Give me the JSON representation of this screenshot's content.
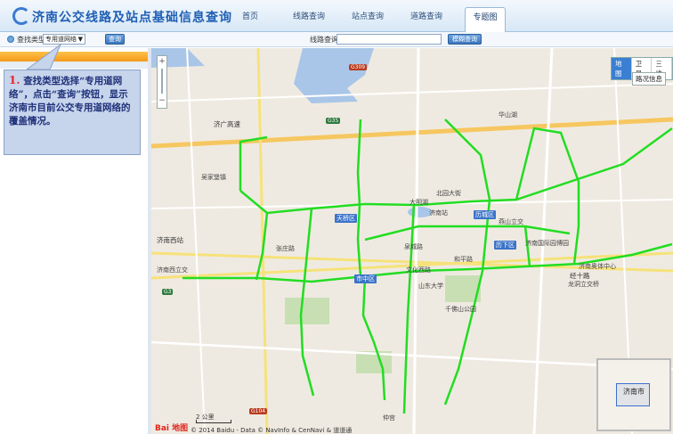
{
  "header": {
    "title": "济南公交线路及站点基础信息查询",
    "nav": [
      {
        "label": "首页",
        "active": false
      },
      {
        "label": "线路查询",
        "active": false
      },
      {
        "label": "站点查询",
        "active": false
      },
      {
        "label": "道路查询",
        "active": false
      },
      {
        "label": "专题图",
        "active": true
      }
    ]
  },
  "toolbar": {
    "find_type_label": "查找类型",
    "find_type_value": "专用道网络",
    "query_button": "查询",
    "line_query_label": "线路查询",
    "fuzzy_query_button": "模糊查询"
  },
  "note": {
    "number": "1.",
    "text": "查找类型选择“专用道网络”，点击“查询”按钮，显示济南市目前公交专用道网络的覆盖情况。"
  },
  "map": {
    "zoom_plus": "+",
    "zoom_minus": "−",
    "map_types": [
      "地图",
      "卫星",
      "三维"
    ],
    "traffic_label": "路况信息",
    "scale_label": "2 公里",
    "copyright": "© 2014 Baidu - Data © NavInfo & CenNavi & 道道通",
    "baidu_logo": "Bai 地图",
    "overview_label": "济南市",
    "route_color": "#22dd22",
    "district_badges": [
      "天桥区",
      "历城区",
      "历下区",
      "市中区"
    ],
    "places": [
      "济广高速",
      "济南西站",
      "吴家堡镇",
      "张庄路",
      "济南站",
      "泉城路",
      "文化西路",
      "经十路",
      "山东大学",
      "千佛山公园",
      "济南奥体中心",
      "龙洞立交桥",
      "济南国际园博园",
      "仲宫",
      "燕山立交",
      "华山湖",
      "北园大街",
      "和平路",
      "济南西立交",
      "大明湖"
    ],
    "highways": [
      "G309",
      "G35",
      "G3",
      "G104"
    ]
  }
}
